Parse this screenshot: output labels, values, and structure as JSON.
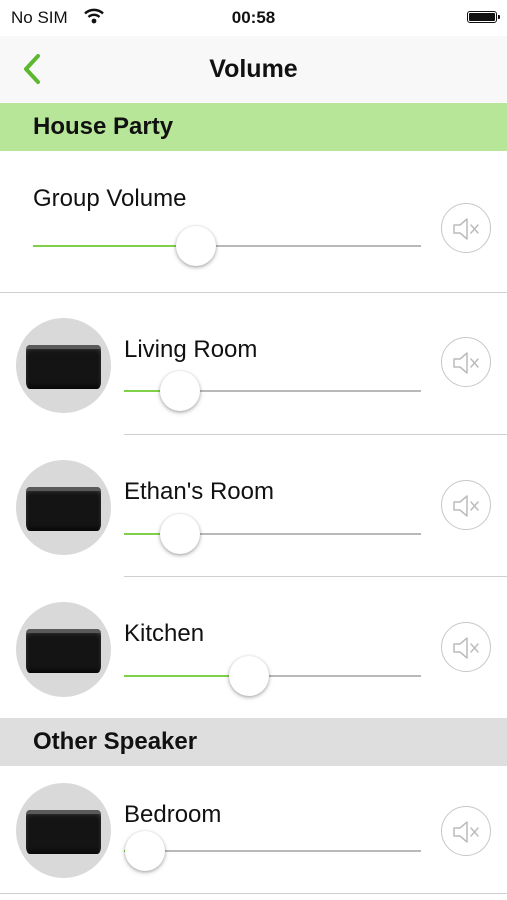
{
  "status_bar": {
    "carrier": "No SIM",
    "time": "00:58"
  },
  "nav": {
    "title": "Volume",
    "back_icon": "chevron-left-icon"
  },
  "colors": {
    "accent": "#7fd14a",
    "party_header": "#b7e698",
    "other_header": "#dedede"
  },
  "group": {
    "name": "House Party",
    "volume_label": "Group Volume",
    "volume": 0.42,
    "speakers": [
      {
        "name": "Living Room",
        "volume": 0.19
      },
      {
        "name": "Ethan's Room",
        "volume": 0.19
      },
      {
        "name": "Kitchen",
        "volume": 0.42
      }
    ]
  },
  "other": {
    "title": "Other Speaker",
    "speakers": [
      {
        "name": "Bedroom",
        "volume": 0.07
      }
    ]
  }
}
